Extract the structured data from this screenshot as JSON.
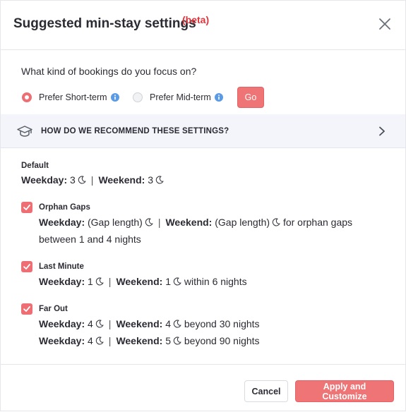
{
  "header": {
    "title": "Suggested min-stay settings",
    "beta": "(beta)"
  },
  "focus": {
    "question": "What kind of bookings do you focus on?",
    "options": [
      {
        "label": "Prefer Short-term",
        "selected": true
      },
      {
        "label": "Prefer Mid-term",
        "selected": false
      }
    ],
    "go_label": "Go"
  },
  "recommend": {
    "label": "HOW DO WE RECOMMEND THESE SETTINGS?"
  },
  "settings": {
    "default": {
      "title": "Default",
      "weekday_label": "Weekday:",
      "weekday_value": "3",
      "weekend_label": "Weekend:",
      "weekend_value": "3"
    },
    "orphan_gaps": {
      "title": "Orphan Gaps",
      "checked": true,
      "weekday_label": "Weekday:",
      "weekday_value": "(Gap length)",
      "weekend_label": "Weekend:",
      "weekend_value": "(Gap length)",
      "suffix": "for orphan gaps",
      "line2": "between 1 and 4 nights"
    },
    "last_minute": {
      "title": "Last Minute",
      "checked": true,
      "weekday_label": "Weekday:",
      "weekday_value": "1",
      "weekend_label": "Weekend:",
      "weekend_value": "1",
      "suffix": "within 6 nights"
    },
    "far_out": {
      "title": "Far Out",
      "checked": true,
      "rows": [
        {
          "weekday_label": "Weekday:",
          "weekday_value": "4",
          "weekend_label": "Weekend:",
          "weekend_value": "4",
          "suffix": "beyond 30 nights"
        },
        {
          "weekday_label": "Weekday:",
          "weekday_value": "4",
          "weekend_label": "Weekend:",
          "weekend_value": "5",
          "suffix": "beyond 90 nights"
        }
      ]
    },
    "separator": "|"
  },
  "footer": {
    "cancel_label": "Cancel",
    "apply_label": "Apply and Customize"
  },
  "colors": {
    "accent": "#ef7476",
    "beta": "#e0343c",
    "info": "#5b9be6",
    "band": "#f3f5fb"
  },
  "icons": {
    "close": "close-icon",
    "info": "info-icon",
    "cap": "graduation-cap-icon",
    "chevron": "chevron-right-icon",
    "moon": "moon-icon",
    "check": "check-icon"
  }
}
